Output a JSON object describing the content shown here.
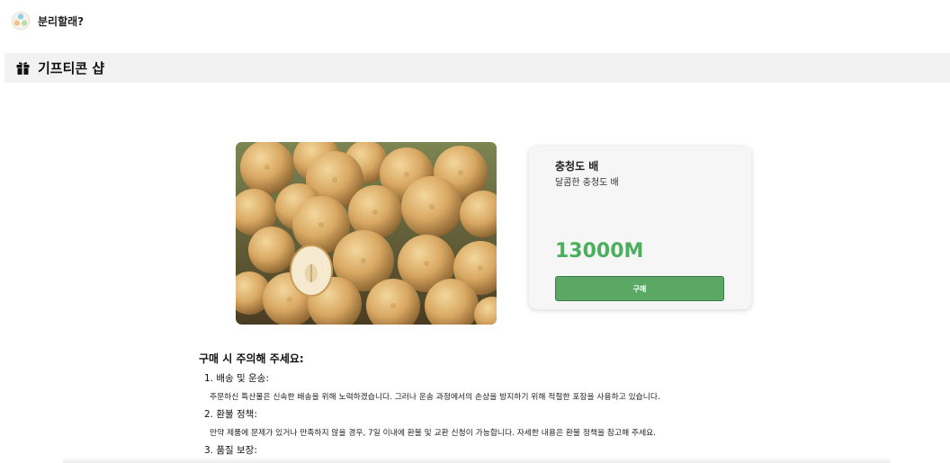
{
  "header": {
    "brand": "분리할래?"
  },
  "section": {
    "title": "기프티콘 샵"
  },
  "product": {
    "name": "충청도 배",
    "description": "달콤한 충청도 배",
    "price": "13000M",
    "buy_label": "구매"
  },
  "notice": {
    "title": "구매 시 주의해 주세요:",
    "items": [
      {
        "heading": "1. 배송 및 운송:",
        "body": "주문하신 특산물은 신속한 배송을 위해 노력하겠습니다. 그러나 운송 과정에서의 손상을 방지하기 위해 적절한 포장을 사용하고 있습니다."
      },
      {
        "heading": "2. 환불 정책:",
        "body": "만약 제품에 문제가 있거나 만족하지 않을 경우, 7일 이내에 환불 및 교환 신청이 가능합니다. 자세한 내용은 환불 정책을 참고해 주세요."
      },
      {
        "heading": "3. 품질 보장:"
      }
    ]
  },
  "icons": {
    "logo": "recycle-logo-icon",
    "section": "gift-icon"
  },
  "colors": {
    "price": "#4caf5f",
    "button": "#5aa864",
    "section_bar": "#f2f2f2"
  }
}
